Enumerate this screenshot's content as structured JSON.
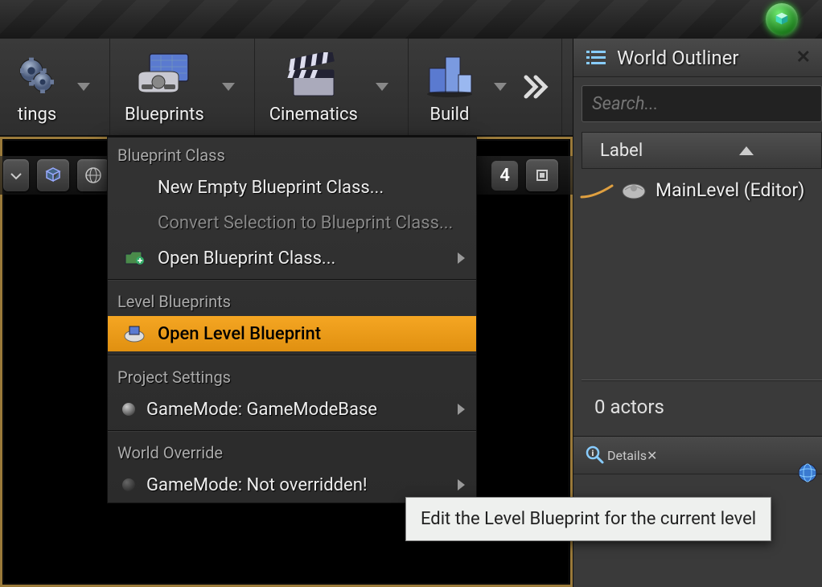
{
  "toolbar": {
    "settings_label": "tings",
    "blueprints_label": "Blueprints",
    "cinematics_label": "Cinematics",
    "build_label": "Build"
  },
  "viewport": {
    "grid_value": "4"
  },
  "outliner": {
    "title": "World Outliner",
    "search_placeholder": "Search...",
    "label_header": "Label",
    "root_item": "MainLevel (Editor)",
    "actor_count": "0 actors"
  },
  "details": {
    "title": "Details"
  },
  "menu": {
    "section_blueprint_class": "Blueprint Class",
    "new_empty": "New Empty Blueprint Class...",
    "convert_selection": "Convert Selection to Blueprint Class...",
    "open_class": "Open Blueprint Class...",
    "section_level": "Level Blueprints",
    "open_level": "Open Level Blueprint",
    "section_project": "Project Settings",
    "gamemode_project": "GameMode: GameModeBase",
    "section_world": "World Override",
    "gamemode_world": "GameMode: Not overridden!"
  },
  "tooltip": {
    "text": "Edit the Level Blueprint for the current level"
  }
}
